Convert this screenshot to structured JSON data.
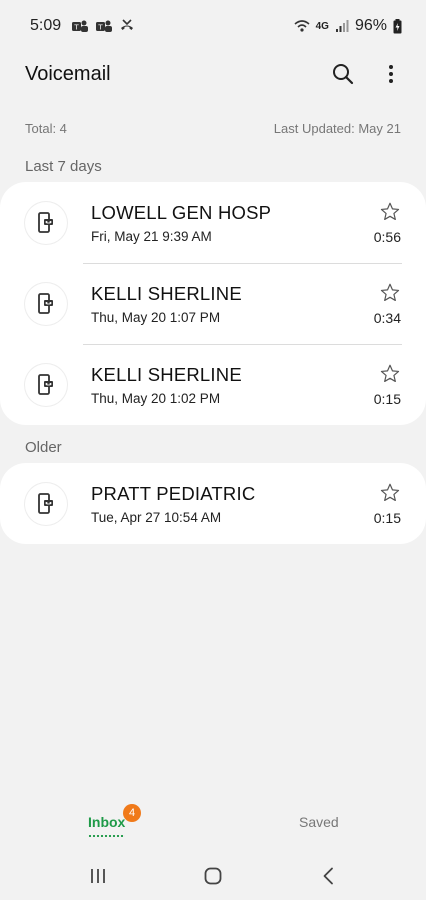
{
  "status_bar": {
    "time": "5:09",
    "network": "4G",
    "battery": "96%"
  },
  "header": {
    "title": "Voicemail",
    "search_icon": "search-icon",
    "more_icon": "more-vert-icon"
  },
  "summary": {
    "total": "Total: 4",
    "last_updated": "Last Updated: May 21"
  },
  "sections": {
    "recent_label": "Last 7 days",
    "older_label": "Older"
  },
  "recent_items": [
    {
      "name": "LOWELL GEN HOSP",
      "date": "Fri, May 21 9:39 AM",
      "duration": "0:56"
    },
    {
      "name": "KELLI SHERLINE",
      "date": "Thu, May 20 1:07 PM",
      "duration": "0:34"
    },
    {
      "name": "KELLI SHERLINE",
      "date": "Thu, May 20 1:02 PM",
      "duration": "0:15"
    }
  ],
  "older_items": [
    {
      "name": "PRATT PEDIATRIC",
      "date": "Tue, Apr 27 10:54 AM",
      "duration": "0:15"
    }
  ],
  "tabs": {
    "inbox": "Inbox",
    "inbox_badge": "4",
    "saved": "Saved"
  },
  "colors": {
    "accent": "#1e9a48",
    "badge": "#f07a1a",
    "background": "#f2f2f2",
    "card": "#ffffff"
  }
}
